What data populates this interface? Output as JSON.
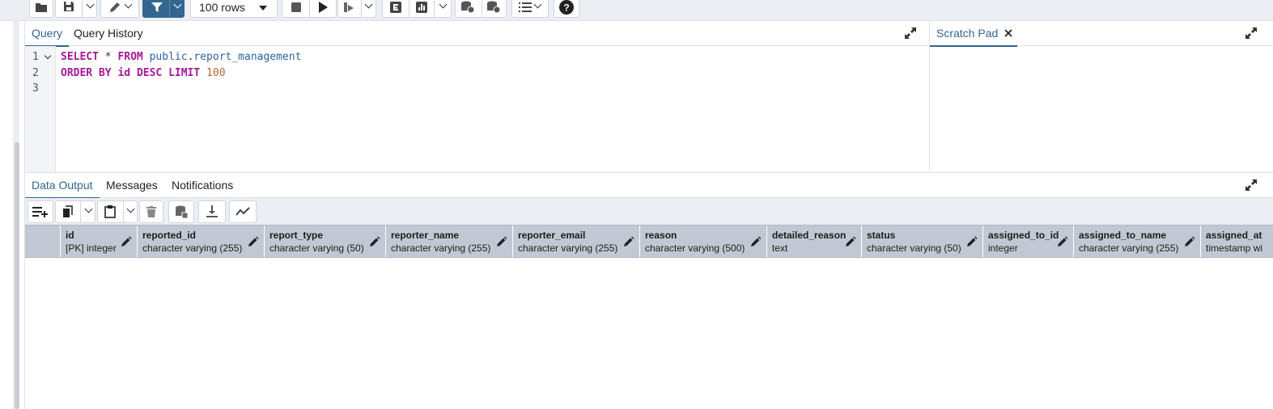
{
  "toolbar": {
    "rows_limit": "100 rows",
    "icons": [
      "folder-icon",
      "save-icon",
      "edit-icon",
      "filter-icon",
      "stop-icon",
      "execute-icon",
      "explain-icon",
      "explain-analyze-icon",
      "chart-icon",
      "commit-icon",
      "rollback-icon",
      "macros-icon",
      "help-icon"
    ]
  },
  "query_panel": {
    "tabs": [
      "Query",
      "Query History"
    ],
    "line_numbers": [
      "1",
      "2",
      "3"
    ],
    "code": {
      "line1": {
        "kw1": "SELECT",
        "star": " * ",
        "kw2": "FROM",
        "sp": " ",
        "schema": "public",
        "dot": ".",
        "table": "report_management"
      },
      "line2": {
        "kw1": "ORDER BY",
        "sp1": " ",
        "col": "id",
        "sp2": " ",
        "kw2": "DESC LIMIT",
        "sp3": " ",
        "limit": "100"
      }
    }
  },
  "scratch_pad": {
    "title": "Scratch Pad"
  },
  "results": {
    "tabs": [
      "Data Output",
      "Messages",
      "Notifications"
    ],
    "columns": [
      {
        "name": "id",
        "type": "[PK] integer"
      },
      {
        "name": "reported_id",
        "type": "character varying (255)"
      },
      {
        "name": "report_type",
        "type": "character varying (50)"
      },
      {
        "name": "reporter_name",
        "type": "character varying (255)"
      },
      {
        "name": "reporter_email",
        "type": "character varying (255)"
      },
      {
        "name": "reason",
        "type": "character varying (500)"
      },
      {
        "name": "detailed_reason",
        "type": "text"
      },
      {
        "name": "status",
        "type": "character varying (50)"
      },
      {
        "name": "assigned_to_id",
        "type": "integer"
      },
      {
        "name": "assigned_to_name",
        "type": "character varying (255)"
      },
      {
        "name": "assigned_at",
        "type": "timestamp wi"
      }
    ]
  },
  "colors": {
    "accent": "#326690",
    "header_bg": "#c2c8d3",
    "keyword": "#a7189a",
    "identifier": "#2b63a6",
    "number": "#b2653a"
  }
}
